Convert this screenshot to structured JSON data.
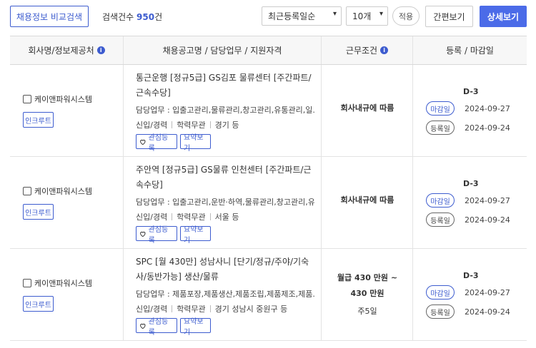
{
  "toolbar": {
    "compare_label": "채용정보 비교검색",
    "count_prefix": "검색건수",
    "count_value": "950",
    "count_suffix": "건",
    "sort_value": "최근등록일순",
    "per_page_value": "10개",
    "apply_label": "적용",
    "simple_view_label": "간편보기",
    "detail_view_label": "상세보기"
  },
  "table": {
    "headers": [
      "회사명/정보제공처",
      "채용공고명 / 담당업무 / 지원자격",
      "근무조건",
      "등록 / 마감일"
    ],
    "rows": [
      {
        "company": "케이앤파워시스템",
        "source": "인크루트",
        "title": "통근운행 [정규5급] GS김포 물류센터 [주간파트/근속수당]",
        "duty": "담당업무 : 입출고관리,물류관리,창고관리,유통관리,일...",
        "experience": "신입/경력",
        "education": "학력무관",
        "region": "경기 등",
        "fav_label": "관심등록",
        "summary_label": "요약보기",
        "conditions": [
          "회사내규에 따름"
        ],
        "dday": "D-3",
        "deadline_label": "마감일",
        "deadline": "2024-09-27",
        "reg_label": "등록일",
        "reg": "2024-09-24"
      },
      {
        "company": "케이앤파워시스템",
        "source": "인크루트",
        "title": "주안역 [정규5급] GS물류 인천센터 [주간파트/근속수당]",
        "duty": "담당업무 : 입출고관리,운반·하역,물류관리,창고관리,유...",
        "experience": "신입/경력",
        "education": "학력무관",
        "region": "서울 등",
        "fav_label": "관심등록",
        "summary_label": "요약보기",
        "conditions": [
          "회사내규에 따름"
        ],
        "dday": "D-3",
        "deadline_label": "마감일",
        "deadline": "2024-09-27",
        "reg_label": "등록일",
        "reg": "2024-09-24"
      },
      {
        "company": "케이앤파워시스템",
        "source": "인크루트",
        "title": "SPC [월 430만] 성남사니 [단기/정규/주야/기숙사/동반가능] 생산/물류",
        "duty": "담당업무 : 제품포장,제품생산,제품조립,제품제조,제품...",
        "experience": "신입/경력",
        "education": "학력무관",
        "region": "경기 성남시 중원구 등",
        "fav_label": "관심등록",
        "summary_label": "요약보기",
        "conditions": [
          "월급 430 만원 ~",
          "430 만원",
          "주5일"
        ],
        "dday": "D-3",
        "deadline_label": "마감일",
        "deadline": "2024-09-27",
        "reg_label": "등록일",
        "reg": "2024-09-24"
      }
    ]
  },
  "colors": {
    "accent": "#3d5ccf",
    "primary_button": "#4b6be8",
    "header_bg": "#f7f7f7"
  },
  "icons": {
    "info": "info-icon",
    "heart": "heart-icon",
    "dropdown": "chevron-down-icon"
  }
}
